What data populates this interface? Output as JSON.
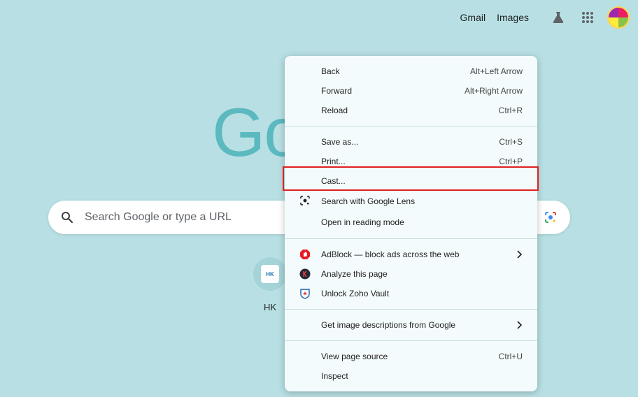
{
  "topbar": {
    "gmail": "Gmail",
    "images": "Images"
  },
  "logo": {
    "text": "Go"
  },
  "search": {
    "placeholder": "Search Google or type a URL"
  },
  "shortcut": {
    "label": "HK",
    "favicon_text": "HK"
  },
  "menu": {
    "group1": [
      {
        "label": "Back",
        "shortcut": "Alt+Left Arrow"
      },
      {
        "label": "Forward",
        "shortcut": "Alt+Right Arrow"
      },
      {
        "label": "Reload",
        "shortcut": "Ctrl+R"
      }
    ],
    "group2": [
      {
        "label": "Save as...",
        "shortcut": "Ctrl+S"
      },
      {
        "label": "Print...",
        "shortcut": "Ctrl+P"
      },
      {
        "label": "Cast..."
      },
      {
        "label": "Search with Google Lens",
        "icon": "lens-icon"
      },
      {
        "label": "Open in reading mode"
      }
    ],
    "group3": [
      {
        "label": "AdBlock — block ads across the web",
        "icon": "adblock-icon"
      },
      {
        "label": "Analyze this page",
        "icon": "analyze-icon"
      },
      {
        "label": "Unlock Zoho Vault",
        "icon": "zoho-vault-icon"
      }
    ],
    "group4": [
      {
        "label": "Get image descriptions from Google"
      }
    ],
    "group5": [
      {
        "label": "View page source",
        "shortcut": "Ctrl+U"
      },
      {
        "label": "Inspect"
      }
    ]
  },
  "colors": {
    "background": "#b8e0e4",
    "highlight": "#e0201f",
    "adblock": "#e51c23"
  }
}
